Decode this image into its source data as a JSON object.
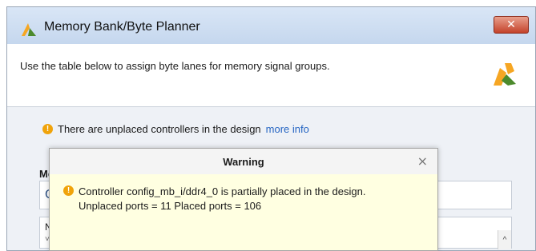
{
  "window": {
    "title": "Memory Bank/Byte Planner",
    "close_glyph": "✕"
  },
  "header": {
    "instruction": "Use the table below to assign byte lanes for memory signal groups.",
    "logo_icon": "xilinx-logo-icon"
  },
  "content": {
    "warning_glyph": "!",
    "warning_text": "There are unplaced controllers in the design",
    "more_info_link": "more info",
    "section_label_partial": "Me",
    "panel_letter_partial": "C",
    "table_header_partial": "N",
    "expander_glyph": "˅",
    "scroll_up_glyph": "^"
  },
  "dialog": {
    "title": "Warning",
    "close_glyph": "×",
    "icon_glyph": "!",
    "message_line1": "Controller config_mb_i/ddr4_0 is partially placed in the design.",
    "message_line2": "Unplaced ports = 11 Placed ports = 106"
  },
  "colors": {
    "warning_icon": "#f0a30a",
    "link": "#2766c3",
    "close_button": "#c4432b",
    "dialog_body": "#ffffe1",
    "logo_orange": "#f6a623",
    "logo_green": "#4c8a2c"
  }
}
